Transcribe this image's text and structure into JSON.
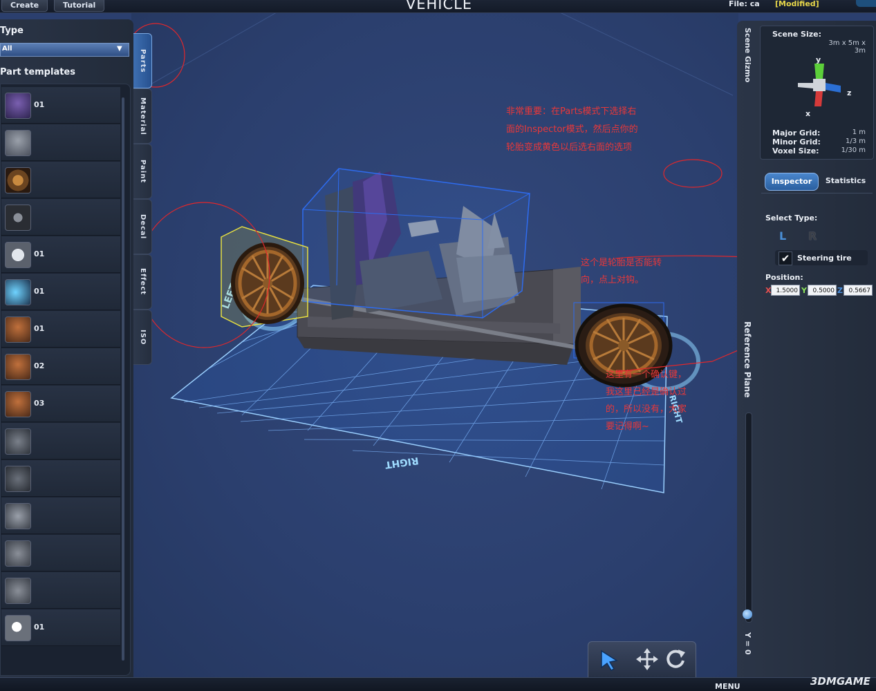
{
  "topbar": {
    "create_label": "Create",
    "tutorial_label": "Tutorial",
    "app_title": "VEHICLE",
    "file_label": "File: ca",
    "modified_label": "[Modified]"
  },
  "left_panel": {
    "type_label": "Type",
    "type_value": "All",
    "templates_label": "Part templates",
    "items": [
      {
        "label": "01",
        "icon": "seat-icon"
      },
      {
        "label": "",
        "icon": "chair-icon"
      },
      {
        "label": "",
        "icon": "wooden-wheel-icon"
      },
      {
        "label": "",
        "icon": "tire-icon"
      },
      {
        "label": "01",
        "icon": "alloy-wheel-icon"
      },
      {
        "label": "01",
        "icon": "thruster-icon"
      },
      {
        "label": "01",
        "icon": "engine-icon"
      },
      {
        "label": "02",
        "icon": "engine-icon"
      },
      {
        "label": "03",
        "icon": "engine-icon"
      },
      {
        "label": "",
        "icon": "gun-icon"
      },
      {
        "label": "",
        "icon": "cannon-icon"
      },
      {
        "label": "",
        "icon": "launcher-icon"
      },
      {
        "label": "",
        "icon": "turret-icon"
      },
      {
        "label": "",
        "icon": "turret-icon"
      },
      {
        "label": "01",
        "icon": "headlight-icon"
      }
    ]
  },
  "tabs": {
    "parts": "Parts",
    "material": "Material",
    "paint": "Paint",
    "decal": "Decal",
    "effect": "Effect",
    "iso": "ISO"
  },
  "scene": {
    "left_marker": "LEFT",
    "right_marker": "RIGHT",
    "front_marker": "RIGHT"
  },
  "right_panel": {
    "scene_gizmo_label": "Scene Gizmo",
    "scene_size_label": "Scene Size:",
    "scene_size_value": "3m x 5m x 3m",
    "axis_y": "y",
    "axis_x": "x",
    "axis_z": "z",
    "major_grid_label": "Major Grid:",
    "major_grid_value": "1 m",
    "minor_grid_label": "Minor Grid:",
    "minor_grid_value": "1/3 m",
    "voxel_size_label": "Voxel Size:",
    "voxel_size_value": "1/30 m",
    "inspector_tab": "Inspector",
    "statistics_tab": "Statistics",
    "select_type_label": "Select Type:",
    "type_l": "L",
    "type_r": "R",
    "steering_label": "Steering tire",
    "steering_check": "✔",
    "position_label": "Position:",
    "x_label": "X",
    "y_label": "Y",
    "z_label": "Z",
    "x_value": "1.5000",
    "y_value": "0.5000",
    "z_value": "0.5667",
    "reference_plane_label": "Reference Plane",
    "y_equals_label": "Y = 0"
  },
  "toolbar": {
    "select_icon": "cursor-arrow-icon",
    "move_icon": "move-arrows-icon",
    "rotate_icon": "rotate-icon"
  },
  "bottom": {
    "menu_label": "MENU",
    "watermark": "3DMGAME"
  },
  "annotations": {
    "note1_line1": "非常重要：在Parts模式下选择右",
    "note1_line2": "面的Inspector模式，然后点你的",
    "note1_line3": "轮胎变成黄色以后选右面的选项",
    "note2_line1": "这个是轮胎是否能转",
    "note2_line2": "向，点上对钩。",
    "note3_line1": "这里有一个确认键，",
    "note3_line2": "我这里已经是确认过",
    "note3_line3": "的，所以没有，大家",
    "note3_line4": "要记得啊~"
  },
  "colors": {
    "accent_blue": "#3d84d2",
    "selection_yellow": "#e8e040",
    "annotation_red": "#e8383a",
    "modified_yellow": "#e8d84a"
  }
}
